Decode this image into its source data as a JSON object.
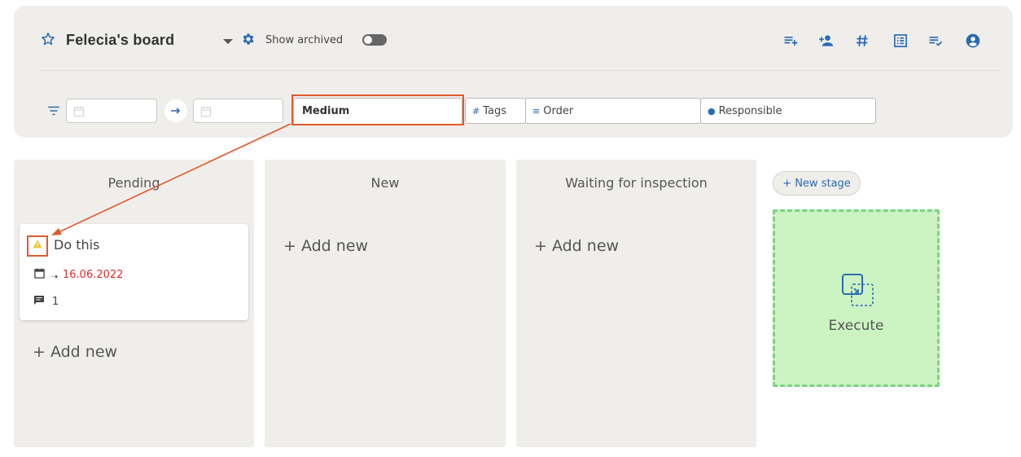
{
  "board": {
    "title": "Felecia's board",
    "show_archived_label": "Show archived",
    "show_archived_on": false
  },
  "toolbar": {
    "icons": [
      "add-list-icon",
      "add-member-icon",
      "hashtag-icon",
      "list-view-icon",
      "checklist-icon",
      "account-icon"
    ]
  },
  "filters": {
    "start_date": "",
    "end_date": "",
    "priority_value": "Medium",
    "tags_label": "Tags",
    "order_label": "Order",
    "responsible_label": "Responsible"
  },
  "columns": [
    {
      "title": "Pending",
      "add_new_label": "+ Add new"
    },
    {
      "title": "New",
      "add_new_label": "+ Add new"
    },
    {
      "title": "Waiting for inspection",
      "add_new_label": "+ Add new"
    }
  ],
  "card": {
    "title": "Do this",
    "due_date": "16.06.2022",
    "comment_count": "1",
    "priority_icon": "warning-icon"
  },
  "new_stage_label": "+ New stage",
  "execute_label": "Execute",
  "colors": {
    "accent": "#2a6ab5",
    "overdue": "#e02c2c",
    "annotation": "#e05a2b",
    "execute_bg": "#ccf4c2",
    "panel_bg": "#efeeeb"
  }
}
